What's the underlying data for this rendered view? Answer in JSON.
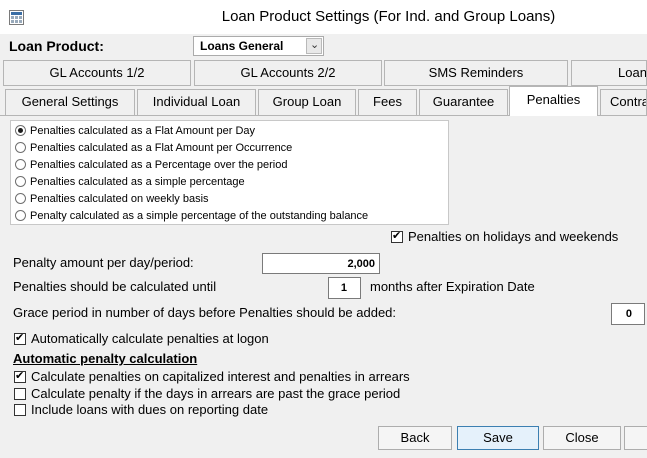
{
  "window": {
    "title": "Loan Product Settings (For Ind. and Group Loans)"
  },
  "loan_product": {
    "label": "Loan Product:",
    "value": "Loans General"
  },
  "tabs_row1": [
    "GL Accounts 1/2",
    "GL Accounts 2/2",
    "SMS Reminders",
    "Loan"
  ],
  "tabs_row2": [
    "General Settings",
    "Individual Loan",
    "Group Loan",
    "Fees",
    "Guarantee",
    "Penalties",
    "Contra"
  ],
  "active_tab": "Penalties",
  "penalty_methods": [
    "Penalties calculated as a Flat Amount per Day",
    "Penalties calculated as a Flat Amount per Occurrence",
    "Penalties calculated as a Percentage over the period",
    "Penalties calculated as a simple percentage",
    "Penalties calculated on weekly basis",
    "Penalty calculated as a simple percentage of the outstanding balance"
  ],
  "selected_method_index": 0,
  "holidays_check": {
    "label": "Penalties on holidays and weekends",
    "checked": true
  },
  "penalty_amount": {
    "label": "Penalty amount per day/period:",
    "value": "2,000"
  },
  "calc_until": {
    "label": "Penalties should be calculated until",
    "value": "1",
    "suffix": "months after Expiration Date"
  },
  "grace_period": {
    "label": "Grace period in number of days before Penalties should be added:",
    "value": "0"
  },
  "auto_logon": {
    "label": "Automatically calculate penalties at logon",
    "checked": true
  },
  "auto_section": {
    "title": "Automatic penalty calculation",
    "items": [
      {
        "label": "Calculate penalties on capitalized interest and penalties in arrears",
        "checked": true
      },
      {
        "label": "Calculate penalty if the days in arrears are past the grace period",
        "checked": false
      },
      {
        "label": "Include loans with dues on reporting date",
        "checked": false
      }
    ]
  },
  "buttons": {
    "back": "Back",
    "save": "Save",
    "close": "Close"
  }
}
